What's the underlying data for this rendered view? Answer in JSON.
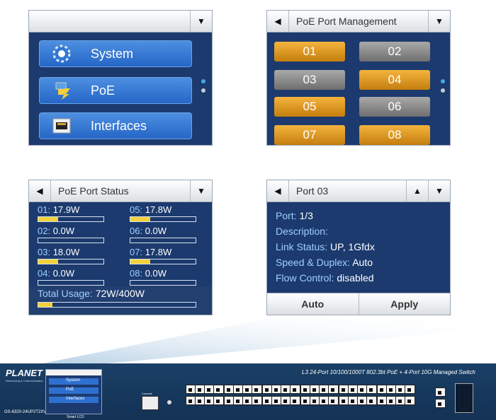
{
  "menu_panel": {
    "items": [
      {
        "label": "System",
        "icon": "gear-icon"
      },
      {
        "label": "PoE",
        "icon": "poe-plug-icon"
      },
      {
        "label": "Interfaces",
        "icon": "ethernet-port-icon"
      }
    ]
  },
  "poe_mgmt": {
    "title": "PoE Port Management",
    "ports": [
      {
        "label": "01",
        "state": "on"
      },
      {
        "label": "02",
        "state": "off"
      },
      {
        "label": "03",
        "state": "off"
      },
      {
        "label": "04",
        "state": "on"
      },
      {
        "label": "05",
        "state": "on"
      },
      {
        "label": "06",
        "state": "off"
      },
      {
        "label": "07",
        "state": "on"
      },
      {
        "label": "08",
        "state": "on"
      }
    ]
  },
  "poe_status": {
    "title": "PoE Port Status",
    "ports": [
      {
        "port": "01:",
        "value": "17.9W",
        "level": 0.3
      },
      {
        "port": "05:",
        "value": "17.8W",
        "level": 0.3
      },
      {
        "port": "02:",
        "value": "0.0W",
        "level": 0
      },
      {
        "port": "06:",
        "value": "0.0W",
        "level": 0
      },
      {
        "port": "03:",
        "value": "18.0W",
        "level": 0.3
      },
      {
        "port": "07:",
        "value": "17.8W",
        "level": 0.3
      },
      {
        "port": "04:",
        "value": "0.0W",
        "level": 0
      },
      {
        "port": "08:",
        "value": "0.0W",
        "level": 0
      }
    ],
    "total_label": "Total Usage:",
    "total_value": "72W/400W",
    "total_level": 0.09
  },
  "port_detail": {
    "title": "Port 03",
    "fields": [
      {
        "key": "Port:",
        "value": "1/3"
      },
      {
        "key": "Description:",
        "value": ""
      },
      {
        "key": "Link Status:",
        "value": "UP, 1Gfdx"
      },
      {
        "key": "Speed & Duplex:",
        "value": "Auto"
      },
      {
        "key": "Flow Control:",
        "value": "disabled"
      }
    ],
    "buttons": [
      "Auto",
      "Apply"
    ]
  },
  "device": {
    "brand": "PLANET",
    "brand_sub": "Networking & Communication",
    "model": "GS-6320-24UP2T2XV",
    "product_title": "L3 24-Port 10/100/1000T 802.3bt PoE + 4-Port 10G Managed Switch",
    "lcd_items": [
      "System",
      "PoE",
      "Interfaces"
    ],
    "lcd_label": "Smart LCD",
    "console_label": "Console"
  },
  "colors": {
    "panel_bg": "#1c3a6e",
    "port_on": "#e29d22",
    "port_off": "#8a8a8a",
    "accent_text": "#9fd0ff",
    "bar_fill": "#f2d23a"
  }
}
